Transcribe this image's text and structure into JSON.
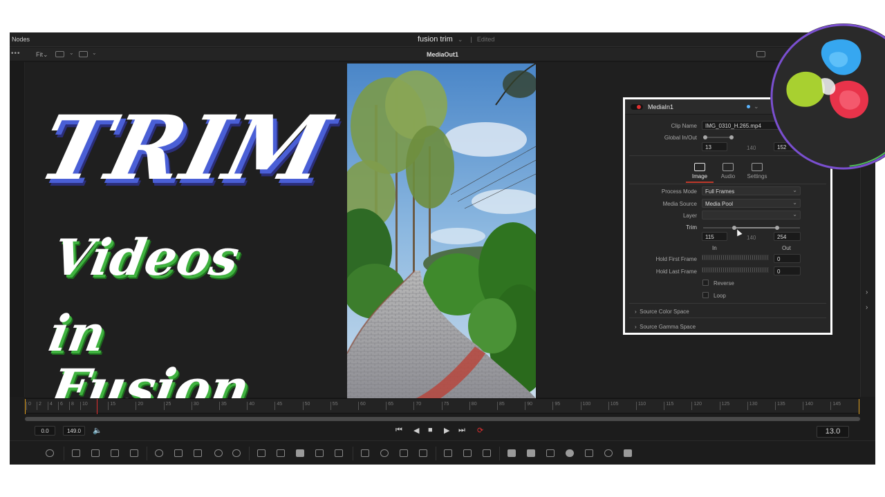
{
  "top_bar": {
    "nodes_label": "Nodes",
    "project_title": "fusion trim",
    "title_status": "Edited"
  },
  "viewer_bar": {
    "dots": "•••",
    "fit_label": "Fit",
    "viewer_name": "MediaOut1"
  },
  "overlay_text": {
    "line1": "TRIM",
    "line2": "Videos",
    "line3": "in",
    "line4": "Fusion",
    "colors": {
      "trim_shadow": "#4a5fd6",
      "green_shadow": "#3fb23f"
    }
  },
  "inspector": {
    "node_name": "MediaIn1",
    "clip_name_label": "Clip Name",
    "clip_name_value": "IMG_0310_H.265.mp4",
    "global_inout_label": "Global In/Out",
    "global_in": "13",
    "global_mid": "140",
    "global_out": "152",
    "tabs": [
      {
        "label": "Image",
        "icon": "image-icon",
        "active": true
      },
      {
        "label": "Audio",
        "icon": "audio-icon",
        "active": false
      },
      {
        "label": "Settings",
        "icon": "settings-icon",
        "active": false
      }
    ],
    "process_mode_label": "Process Mode",
    "process_mode_value": "Full Frames",
    "media_source_label": "Media Source",
    "media_source_value": "Media Pool",
    "layer_label": "Layer",
    "layer_value": "",
    "trim_label": "Trim",
    "trim_in": "115",
    "trim_mid": "140",
    "trim_out": "254",
    "in_label": "In",
    "out_label": "Out",
    "hold_first_label": "Hold First Frame",
    "hold_first_value": "0",
    "hold_last_label": "Hold Last Frame",
    "hold_last_value": "0",
    "reverse_label": "Reverse",
    "loop_label": "Loop",
    "source_color_space": "Source Color Space",
    "source_gamma_space": "Source Gamma Space"
  },
  "timeline": {
    "ticks": [
      "0",
      "2",
      "4",
      "6",
      "8",
      "10",
      "15",
      "20",
      "25",
      "30",
      "35",
      "40",
      "45",
      "50",
      "55",
      "60",
      "65",
      "70",
      "75",
      "80",
      "85",
      "90",
      "95",
      "100",
      "105",
      "110",
      "115",
      "120",
      "125",
      "130",
      "135",
      "140",
      "145"
    ]
  },
  "transport": {
    "start_time": "0.0",
    "end_time": "149.0",
    "current_frame": "13.0",
    "loop_color": "#e03030"
  }
}
